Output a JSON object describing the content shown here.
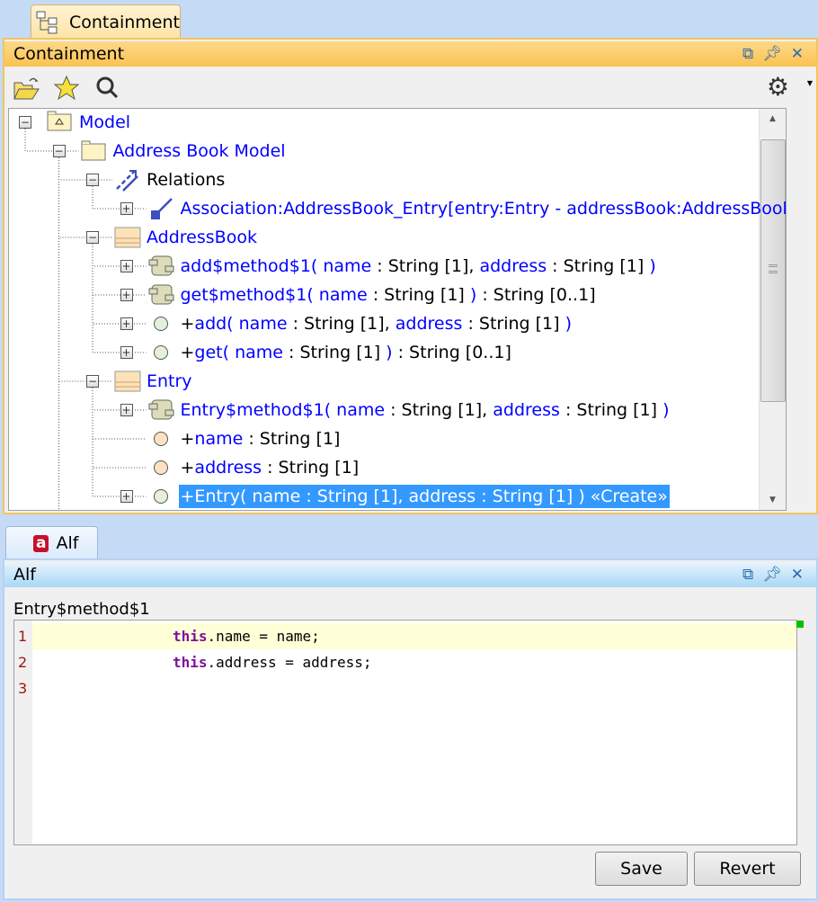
{
  "containment": {
    "tab_label": "Containment",
    "title": "Containment",
    "toolbar": [
      "open-icon",
      "favorite-star-icon",
      "search-icon",
      "settings-gear-icon"
    ],
    "tree": [
      {
        "level": 0,
        "toggle": "minus",
        "icon": "model",
        "parts": [
          {
            "t": "Model",
            "c": "b"
          }
        ]
      },
      {
        "level": 1,
        "toggle": "minus",
        "icon": "folder",
        "parts": [
          {
            "t": "Address Book Model",
            "c": "b"
          }
        ]
      },
      {
        "level": 2,
        "toggle": "minus",
        "icon": "relations",
        "parts": [
          {
            "t": "Relations",
            "c": "k"
          }
        ]
      },
      {
        "level": 3,
        "toggle": "plus",
        "icon": "association",
        "parts": [
          {
            "t": "Association:AddressBook_Entry[entry:Entry - addressBook:AddressBook]",
            "c": "b"
          }
        ]
      },
      {
        "level": 2,
        "toggle": "minus",
        "icon": "class",
        "parts": [
          {
            "t": "AddressBook",
            "c": "b"
          }
        ]
      },
      {
        "level": 3,
        "toggle": "plus",
        "icon": "behavior",
        "parts": [
          {
            "t": "add$method$1( ",
            "c": "b"
          },
          {
            "t": "name",
            "c": "b"
          },
          {
            "t": " : String [1], ",
            "c": "k"
          },
          {
            "t": "address",
            "c": "b"
          },
          {
            "t": " : String [1] ",
            "c": "k"
          },
          {
            "t": ")",
            "c": "b"
          }
        ]
      },
      {
        "level": 3,
        "toggle": "plus",
        "icon": "behavior",
        "parts": [
          {
            "t": "get$method$1( ",
            "c": "b"
          },
          {
            "t": "name",
            "c": "b"
          },
          {
            "t": " : String [1] ",
            "c": "k"
          },
          {
            "t": ")",
            "c": "b"
          },
          {
            "t": " : String [0..1]",
            "c": "k"
          }
        ]
      },
      {
        "level": 3,
        "toggle": "plus",
        "icon": "operation",
        "parts": [
          {
            "t": "+",
            "c": "k"
          },
          {
            "t": "add( ",
            "c": "b"
          },
          {
            "t": "name",
            "c": "b"
          },
          {
            "t": " : String [1], ",
            "c": "k"
          },
          {
            "t": "address",
            "c": "b"
          },
          {
            "t": " : String [1] ",
            "c": "k"
          },
          {
            "t": ")",
            "c": "b"
          }
        ]
      },
      {
        "level": 3,
        "toggle": "plus",
        "icon": "operation",
        "parts": [
          {
            "t": "+",
            "c": "k"
          },
          {
            "t": "get( ",
            "c": "b"
          },
          {
            "t": "name",
            "c": "b"
          },
          {
            "t": " : String [1] ",
            "c": "k"
          },
          {
            "t": ")",
            "c": "b"
          },
          {
            "t": " : String [0..1]",
            "c": "k"
          }
        ]
      },
      {
        "level": 2,
        "toggle": "minus",
        "icon": "class",
        "parts": [
          {
            "t": "Entry",
            "c": "b"
          }
        ]
      },
      {
        "level": 3,
        "toggle": "plus",
        "icon": "behavior",
        "parts": [
          {
            "t": "Entry$method$1( ",
            "c": "b"
          },
          {
            "t": "name",
            "c": "b"
          },
          {
            "t": " : String [1], ",
            "c": "k"
          },
          {
            "t": "address",
            "c": "b"
          },
          {
            "t": " : String [1] ",
            "c": "k"
          },
          {
            "t": ")",
            "c": "b"
          }
        ]
      },
      {
        "level": 3,
        "toggle": "none",
        "icon": "property",
        "parts": [
          {
            "t": "+",
            "c": "k"
          },
          {
            "t": "name",
            "c": "b"
          },
          {
            "t": " : String [1]",
            "c": "k"
          }
        ]
      },
      {
        "level": 3,
        "toggle": "none",
        "icon": "property",
        "parts": [
          {
            "t": "+",
            "c": "k"
          },
          {
            "t": "address",
            "c": "b"
          },
          {
            "t": " : String [1]",
            "c": "k"
          }
        ]
      },
      {
        "level": 3,
        "toggle": "plus",
        "icon": "operation",
        "selected": true,
        "parts": [
          {
            "t": "+Entry( name : String [1], address : String [1] ) «Create»",
            "c": "k"
          }
        ]
      }
    ]
  },
  "alf": {
    "tab_label": "Alf",
    "title": "Alf",
    "element_name": "Entry$method$1",
    "lines": [
      {
        "num": "1",
        "kw": "this",
        "rest": ".name = name;"
      },
      {
        "num": "2",
        "kw": "this",
        "rest": ".address = address;"
      },
      {
        "num": "3",
        "kw": "",
        "rest": ""
      }
    ],
    "save_label": "Save",
    "revert_label": "Revert"
  },
  "colors": {
    "name": "#0000ff",
    "selection": "#3399ff",
    "keyword": "#7f0f9f",
    "line_number": "#a31515"
  }
}
